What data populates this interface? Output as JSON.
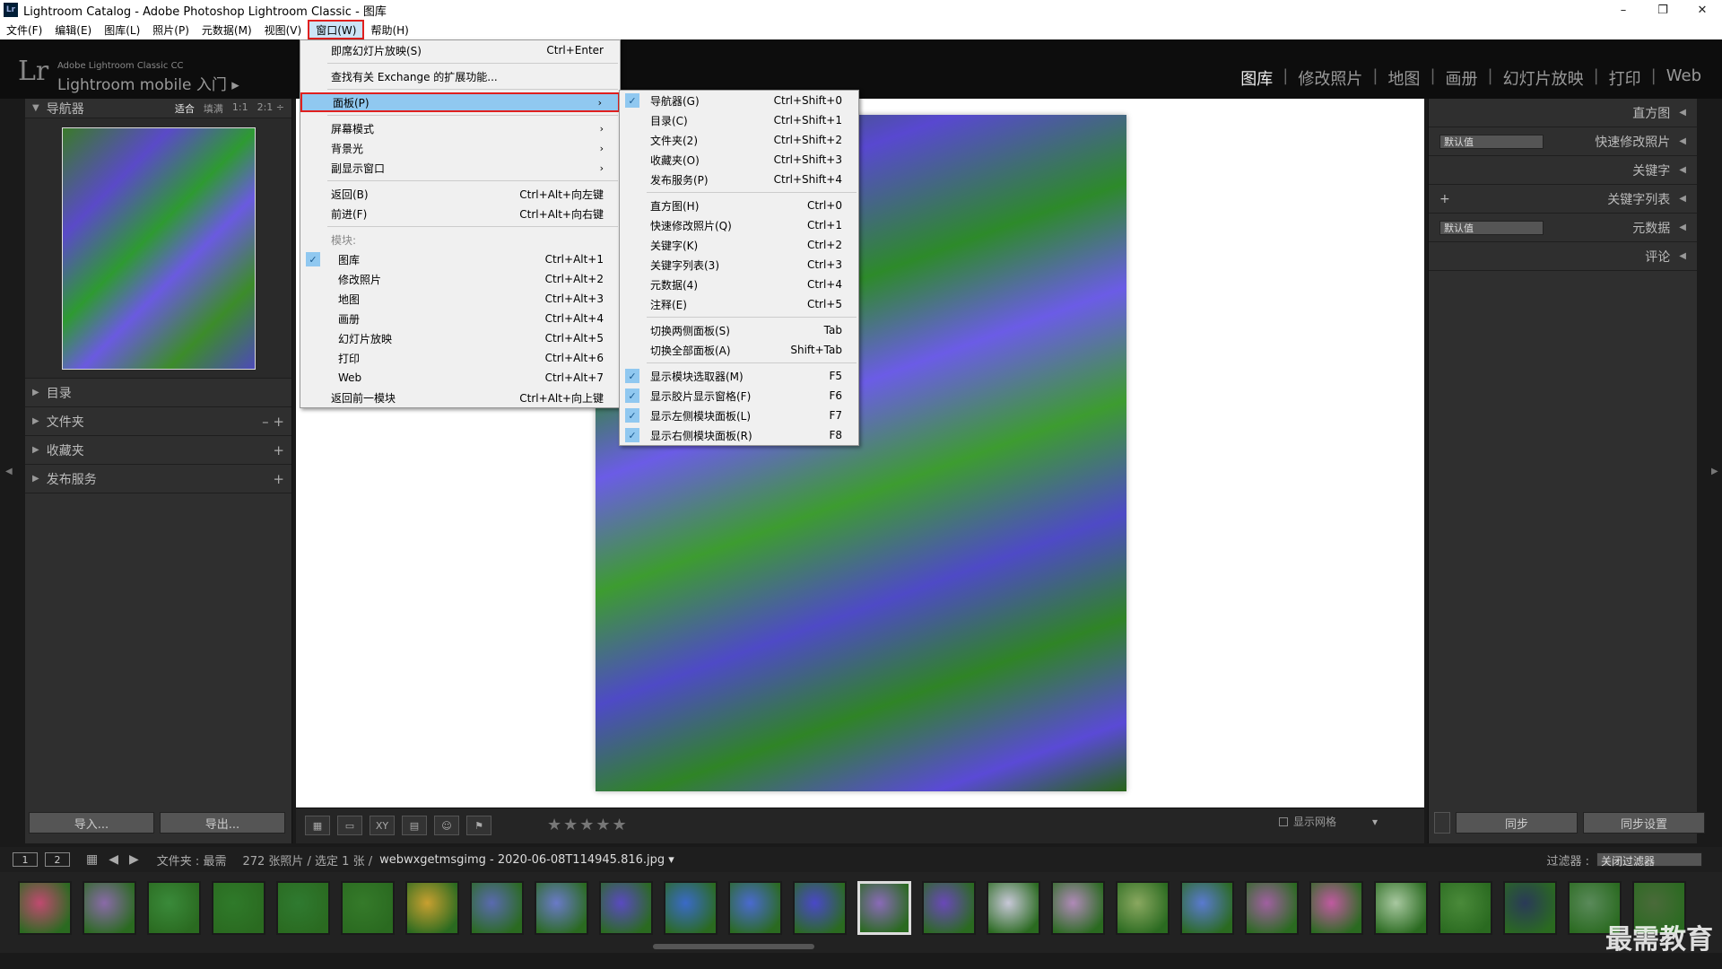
{
  "window": {
    "icon_label": "Lr",
    "title": "Lightroom Catalog - Adobe Photoshop Lightroom Classic - 图库",
    "minimize": "–",
    "restore": "❐",
    "close": "✕"
  },
  "menubar": {
    "items": [
      "文件(F)",
      "编辑(E)",
      "图库(L)",
      "照片(P)",
      "元数据(M)",
      "视图(V)",
      "窗口(W)",
      "帮助(H)"
    ],
    "active_index": 6
  },
  "identity": {
    "logo": "Lr",
    "brand_small": "Adobe Lightroom Classic CC",
    "brand_mobile": "Lightroom mobile 入门 ▸"
  },
  "modules": {
    "items": [
      "图库",
      "修改照片",
      "地图",
      "画册",
      "幻灯片放映",
      "打印",
      "Web"
    ],
    "active": "图库",
    "separator": "|"
  },
  "left_panel": {
    "navigator": {
      "title": "导航器",
      "options": [
        "适合",
        "填满",
        "1:1",
        "2:1 ÷"
      ],
      "active_option": "适合"
    },
    "sections": [
      {
        "label": "目录",
        "actions": ""
      },
      {
        "label": "文件夹",
        "actions": "– +"
      },
      {
        "label": "收藏夹",
        "actions": "+"
      },
      {
        "label": "发布服务",
        "actions": "+"
      }
    ],
    "import_button": "导入...",
    "export_button": "导出..."
  },
  "right_panel": {
    "rows": [
      {
        "label": "直方图",
        "select": "",
        "prefix": ""
      },
      {
        "label": "快速修改照片",
        "select": "默认值",
        "prefix": ""
      },
      {
        "label": "关键字",
        "select": "",
        "prefix": ""
      },
      {
        "label": "关键字列表",
        "select": "",
        "prefix": "+"
      },
      {
        "label": "元数据",
        "select": "默认值",
        "prefix": ""
      },
      {
        "label": "评论",
        "select": "",
        "prefix": ""
      }
    ],
    "sync_button": "同步",
    "sync_settings_button": "同步设置"
  },
  "toolbar": {
    "stars": "★★★★★",
    "grid_label": "显示网格",
    "grid_dropdown": "▾"
  },
  "film_header": {
    "pages": [
      "1",
      "2"
    ],
    "path": "文件夹 : 最需",
    "count": "272 张照片 / 选定 1 张 /",
    "filename": "webwxgetmsgimg - 2020-06-08T114945.816.jpg ▾",
    "filter_label": "过滤器 :",
    "filter_value": "关闭过滤器"
  },
  "watermark": "最需教育",
  "window_menu": {
    "groups": [
      [
        {
          "label": "即席幻灯片放映(S)",
          "shortcut": "Ctrl+Enter"
        }
      ],
      [
        {
          "label": "查找有关 Exchange 的扩展功能...",
          "shortcut": ""
        }
      ],
      [
        {
          "label": "面板(P)",
          "shortcut": "",
          "submenu": true,
          "highlight": true
        }
      ],
      [
        {
          "label": "屏幕模式",
          "submenu": true
        },
        {
          "label": "背景光",
          "submenu": true
        },
        {
          "label": "副显示窗口",
          "submenu": true
        }
      ],
      [
        {
          "label": "返回(B)",
          "shortcut": "Ctrl+Alt+向左键"
        },
        {
          "label": "前进(F)",
          "shortcut": "Ctrl+Alt+向右键"
        }
      ],
      [
        {
          "label": "模块:",
          "group": true
        },
        {
          "label": "图库",
          "shortcut": "Ctrl+Alt+1",
          "checked": true,
          "indent": true
        },
        {
          "label": "修改照片",
          "shortcut": "Ctrl+Alt+2",
          "indent": true
        },
        {
          "label": "地图",
          "shortcut": "Ctrl+Alt+3",
          "indent": true
        },
        {
          "label": "画册",
          "shortcut": "Ctrl+Alt+4",
          "indent": true
        },
        {
          "label": "幻灯片放映",
          "shortcut": "Ctrl+Alt+5",
          "indent": true
        },
        {
          "label": "打印",
          "shortcut": "Ctrl+Alt+6",
          "indent": true
        },
        {
          "label": "Web",
          "shortcut": "Ctrl+Alt+7",
          "indent": true
        },
        {
          "label": "返回前一模块",
          "shortcut": "Ctrl+Alt+向上键"
        }
      ]
    ]
  },
  "panel_submenu": {
    "groups": [
      [
        {
          "label": "导航器(G)",
          "shortcut": "Ctrl+Shift+0",
          "checked": true
        },
        {
          "label": "目录(C)",
          "shortcut": "Ctrl+Shift+1"
        },
        {
          "label": "文件夹(2)",
          "shortcut": "Ctrl+Shift+2"
        },
        {
          "label": "收藏夹(O)",
          "shortcut": "Ctrl+Shift+3"
        },
        {
          "label": "发布服务(P)",
          "shortcut": "Ctrl+Shift+4"
        }
      ],
      [
        {
          "label": "直方图(H)",
          "shortcut": "Ctrl+0"
        },
        {
          "label": "快速修改照片(Q)",
          "shortcut": "Ctrl+1"
        },
        {
          "label": "关键字(K)",
          "shortcut": "Ctrl+2"
        },
        {
          "label": "关键字列表(3)",
          "shortcut": "Ctrl+3"
        },
        {
          "label": "元数据(4)",
          "shortcut": "Ctrl+4"
        },
        {
          "label": "注释(E)",
          "shortcut": "Ctrl+5"
        }
      ],
      [
        {
          "label": "切换两侧面板(S)",
          "shortcut": "Tab"
        },
        {
          "label": "切换全部面板(A)",
          "shortcut": "Shift+Tab"
        }
      ],
      [
        {
          "label": "显示模块选取器(M)",
          "shortcut": "F5",
          "checked": true
        },
        {
          "label": "显示胶片显示窗格(F)",
          "shortcut": "F6",
          "checked": true
        },
        {
          "label": "显示左侧模块面板(L)",
          "shortcut": "F7",
          "checked": true
        },
        {
          "label": "显示右侧模块面板(R)",
          "shortcut": "F8",
          "checked": true
        }
      ]
    ]
  }
}
